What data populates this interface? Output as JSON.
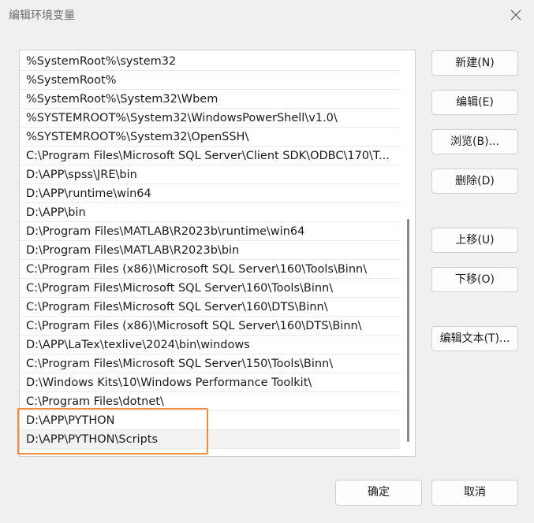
{
  "window": {
    "title": "编辑环境变量"
  },
  "paths": [
    "%SystemRoot%\\system32",
    "%SystemRoot%",
    "%SystemRoot%\\System32\\Wbem",
    "%SYSTEMROOT%\\System32\\WindowsPowerShell\\v1.0\\",
    "%SYSTEMROOT%\\System32\\OpenSSH\\",
    "C:\\Program Files\\Microsoft SQL Server\\Client SDK\\ODBC\\170\\T...",
    "D:\\APP\\spss\\JRE\\bin",
    "D:\\APP\\runtime\\win64",
    "D:\\APP\\bin",
    "D:\\Program Files\\MATLAB\\R2023b\\runtime\\win64",
    "D:\\Program Files\\MATLAB\\R2023b\\bin",
    "C:\\Program Files (x86)\\Microsoft SQL Server\\160\\Tools\\Binn\\",
    "C:\\Program Files\\Microsoft SQL Server\\160\\Tools\\Binn\\",
    "C:\\Program Files\\Microsoft SQL Server\\160\\DTS\\Binn\\",
    "C:\\Program Files (x86)\\Microsoft SQL Server\\160\\DTS\\Binn\\",
    "D:\\APP\\LaTex\\texlive\\2024\\bin\\windows",
    "C:\\Program Files\\Microsoft SQL Server\\150\\Tools\\Binn\\",
    "D:\\Windows Kits\\10\\Windows Performance Toolkit\\",
    "C:\\Program Files\\dotnet\\",
    "D:\\APP\\PYTHON",
    "D:\\APP\\PYTHON\\Scripts"
  ],
  "selected_index": 20,
  "buttons": {
    "new": "新建(N)",
    "edit": "编辑(E)",
    "browse": "浏览(B)...",
    "delete": "删除(D)",
    "move_up": "上移(U)",
    "move_down": "下移(O)",
    "edit_text": "编辑文本(T)...",
    "ok": "确定",
    "cancel": "取消"
  },
  "colors": {
    "highlight": "#ef8a3e",
    "background": "#f0f0f0"
  }
}
